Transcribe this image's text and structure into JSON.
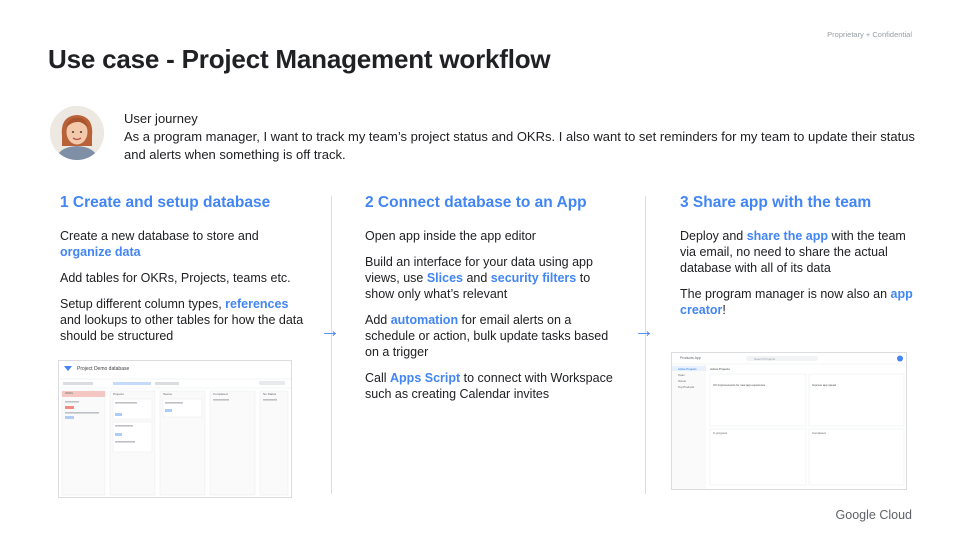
{
  "confidential": "Proprietary + Confidential",
  "title": "Use case - Project Management workflow",
  "journey": {
    "heading": "User journey",
    "text": "As a program manager,  I want to track my team’s project status and OKRs. I also want to set reminders for my team to update their status and alerts when something is off track."
  },
  "col1": {
    "heading": "1 Create and setup database",
    "p1a": "Create a new database to store and ",
    "p1b": "organize data",
    "p2": "Add tables for OKRs, Projects, teams etc.",
    "p3a": "Setup different column types, ",
    "p3b": "references",
    "p3c": " and lookups to other tables for how the data should be structured"
  },
  "col2": {
    "heading": "2 Connect database to an App",
    "p1": "Open app inside the app editor",
    "p2a": "Build an interface for your data using app views, use ",
    "p2b": "Slices",
    "p2c": " and ",
    "p2d": "security filters",
    "p2e": " to show only what’s relevant",
    "p3a": "Add ",
    "p3b": "automation",
    "p3c": " for email alerts on a schedule or action, bulk update tasks based on a trigger",
    "p4a": "Call ",
    "p4b": "Apps Script",
    "p4c": " to connect with Workspace such as creating Calendar invites"
  },
  "col3": {
    "heading": "3 Share app with the team",
    "p1a": "Deploy and ",
    "p1b": "share the app",
    "p1c": " with the team via email, no need to share the actual database with all of its data",
    "p2a": "The program manager is now also an ",
    "p2b": "app creator",
    "p2c": "!"
  },
  "db_shot": {
    "title": "Project Demo database",
    "columns": [
      "OKRs",
      "Projects",
      "Teams",
      "Completed",
      "No Status"
    ]
  },
  "app_shot": {
    "appname": "Products App",
    "search": "Search Projects",
    "nav": [
      "Active Projects",
      "Team",
      "Owner",
      "Top Products"
    ],
    "header": "Active Projects",
    "card1_title": "UX Improvements for new app experience",
    "card2_title": "Improve app speed",
    "sec1": "In progress",
    "sec2": "Completed"
  },
  "brand": "Google Cloud",
  "arrows": [
    "→",
    "→"
  ],
  "colors": {
    "accent": "#4285f4",
    "text": "#202124",
    "muted": "#9aa0a6",
    "divider": "#dadce0"
  }
}
